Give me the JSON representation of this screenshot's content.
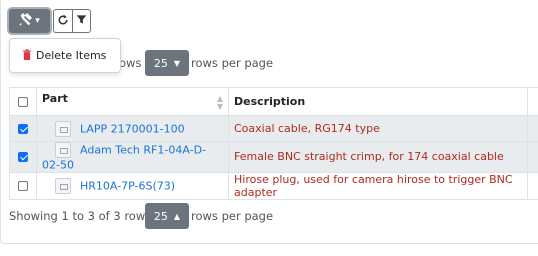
{
  "toolbar": {
    "actions_icon": "tools-icon",
    "caret": "▾",
    "refresh_icon": "refresh-icon",
    "filter_icon": "filter-icon"
  },
  "actions_menu": {
    "items": [
      {
        "label": "Delete Items",
        "icon": "trash-icon",
        "color": "#dc3545"
      }
    ]
  },
  "top_pager": {
    "rows_text_fragment": "ows",
    "page_size": "25",
    "suffix": "rows per page"
  },
  "table": {
    "columns": [
      "Part",
      "Description"
    ],
    "rows": [
      {
        "selected": true,
        "part": "LAPP 2170001-100",
        "description": "Coaxial cable, RG174 type"
      },
      {
        "selected": true,
        "part": "Adam Tech RF1-04A-D-02-50",
        "description": "Female BNC straight crimp, for 174 coaxial cable"
      },
      {
        "selected": false,
        "part": "HR10A-7P-6S(73)",
        "description": "Hirose plug, used for camera hirose to trigger BNC adapter"
      }
    ]
  },
  "bottom_pager": {
    "showing": "Showing 1 to 3 of 3 rows",
    "page_size": "25",
    "suffix": "rows per page"
  },
  "colors": {
    "accent": "#6c757d",
    "link": "#1a73d9",
    "description": "#b02a1f",
    "selected_row": "#e9ecef"
  }
}
